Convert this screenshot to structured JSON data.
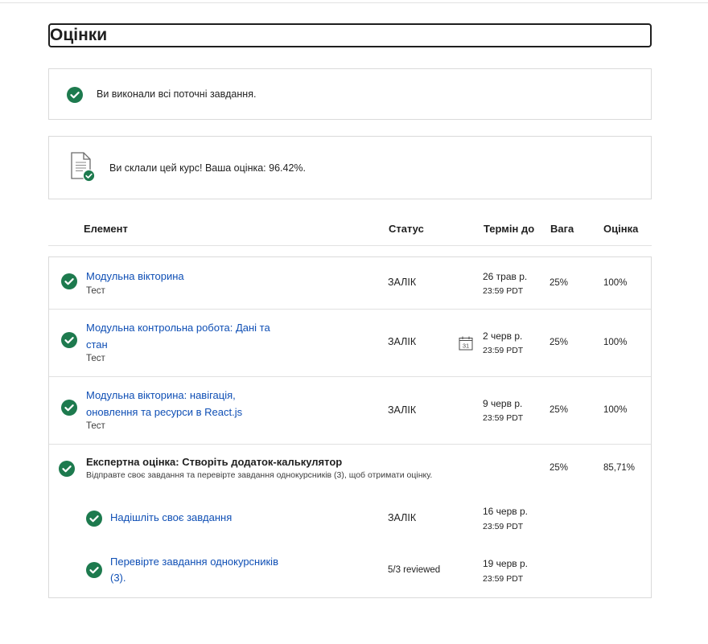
{
  "page": {
    "title": "Оцінки"
  },
  "notice_tasks": {
    "text": "Ви виконали всі поточні завдання."
  },
  "notice_course": {
    "text": "Ви склали цей курс! Ваша оцінка: 96.42%."
  },
  "table": {
    "headers": {
      "item": "Елемент",
      "status": "Статус",
      "due": "Термін до",
      "weight": "Вага",
      "grade": "Оцінка"
    },
    "rows": [
      {
        "title": "Модульна вікторина",
        "type": "Тест",
        "status": "ЗАЛІК",
        "due_date": "26 трав р.",
        "due_time": "23:59 PDT",
        "weight": "25%",
        "grade": "100%"
      },
      {
        "title": "Модульна контрольна робота: Дані та стан",
        "type": "Тест",
        "status": "ЗАЛІК",
        "due_date": "2 черв р.",
        "due_time": "23:59 PDT",
        "weight": "25%",
        "grade": "100%",
        "calendar_day": "31"
      },
      {
        "title": "Модульна вікторина: навігація, оновлення та ресурси в React.js",
        "type": "Тест",
        "status": "ЗАЛІК",
        "due_date": "9 черв р.",
        "due_time": "23:59 PDT",
        "weight": "25%",
        "grade": "100%"
      }
    ],
    "peer": {
      "title": "Експертна оцінка: Створіть додаток-калькулятор",
      "subtitle": "Відправте своє завдання та перевірте завдання однокурсників (3), щоб отримати оцінку.",
      "weight": "25%",
      "grade": "85,71%",
      "subitems": [
        {
          "title": "Надішліть своє завдання",
          "status": "ЗАЛІК",
          "due_date": "16 черв р.",
          "due_time": "23:59 PDT"
        },
        {
          "title": "Перевірте завдання однокурсників (3).",
          "status": "5/3 reviewed",
          "due_date": "19 черв р.",
          "due_time": "23:59 PDT"
        }
      ]
    }
  },
  "colors": {
    "accent_green": "#1d7a4e",
    "link_blue": "#0f4fb5",
    "border": "#dadada"
  }
}
